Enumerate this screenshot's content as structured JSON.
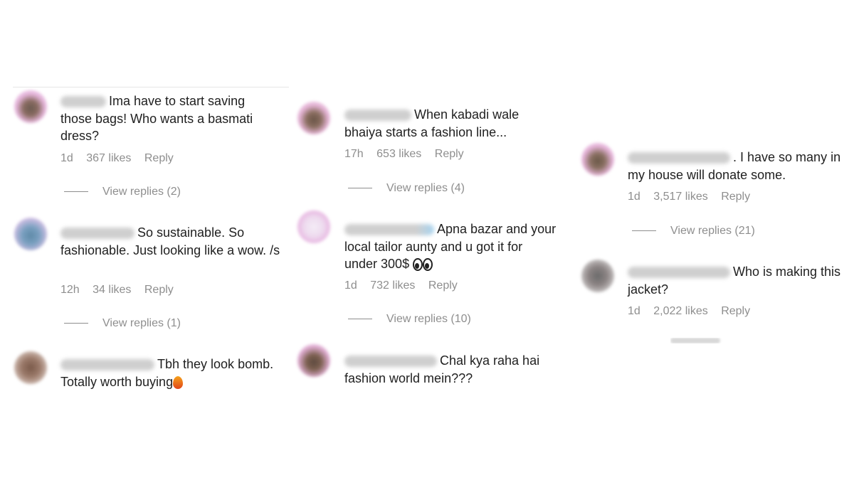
{
  "comments": [
    {
      "text": "Ima have to start saving those bags! Who wants a basmati dress?",
      "time": "1d",
      "likes": "367 likes",
      "reply": "Reply",
      "view_replies": "View replies (2)"
    },
    {
      "text": "So sustainable. So fashionable. Just looking like a wow. /s",
      "time": "12h",
      "likes": "34 likes",
      "reply": "Reply",
      "view_replies": "View replies (1)"
    },
    {
      "text": "Tbh they look bomb. Totally worth buying"
    },
    {
      "text": "When kabadi wale bhaiya starts a fashion line...",
      "time": "17h",
      "likes": "653 likes",
      "reply": "Reply",
      "view_replies": "View replies (4)"
    },
    {
      "text": "Apna bazar and your local tailor aunty and u got it for under 300$",
      "time": "1d",
      "likes": "732 likes",
      "reply": "Reply",
      "view_replies": "View replies (10)"
    },
    {
      "text": "Chal kya raha hai fashion world mein???"
    },
    {
      "text": ". I have so many in my house will donate some.",
      "time": "1d",
      "likes": "3,517 likes",
      "reply": "Reply",
      "view_replies": "View replies (21)"
    },
    {
      "text": "Who is making this jacket?",
      "time": "1d",
      "likes": "2,022 likes",
      "reply": "Reply"
    }
  ],
  "icons": {
    "fire": "fire-emoji-icon",
    "eyes": "eyes-emoji-icon"
  }
}
